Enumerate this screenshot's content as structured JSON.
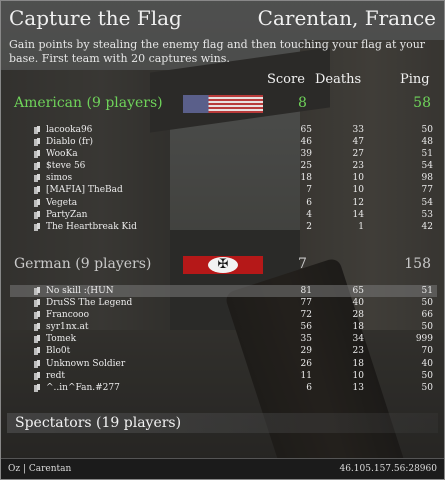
{
  "header": {
    "mode": "Capture the Flag",
    "map": "Carentan, France",
    "description": "Gain points by stealing the enemy flag and then touching your flag at your base. First team with 20 captures wins."
  },
  "columns": {
    "score": "Score",
    "deaths": "Deaths",
    "ping": "Ping"
  },
  "teams": [
    {
      "name": "American (9 players)",
      "score": "8",
      "ping": "58",
      "color": "#6fd35a",
      "players": [
        {
          "name": "lacooka96",
          "score": "65",
          "deaths": "33",
          "ping": "50"
        },
        {
          "name": "Diablo (fr)",
          "score": "46",
          "deaths": "47",
          "ping": "48"
        },
        {
          "name": "WooKa",
          "score": "39",
          "deaths": "27",
          "ping": "51"
        },
        {
          "name": "$teve 56",
          "score": "25",
          "deaths": "23",
          "ping": "54"
        },
        {
          "name": "simos",
          "score": "18",
          "deaths": "10",
          "ping": "98"
        },
        {
          "name": "[MAFIA] TheBad",
          "score": "7",
          "deaths": "10",
          "ping": "77"
        },
        {
          "name": "Vegeta",
          "score": "6",
          "deaths": "12",
          "ping": "54"
        },
        {
          "name": "PartyZan",
          "score": "4",
          "deaths": "14",
          "ping": "53"
        },
        {
          "name": "The Heartbreak Kid",
          "score": "2",
          "deaths": "1",
          "ping": "42"
        }
      ]
    },
    {
      "name": "German (9 players)",
      "score": "7",
      "ping": "158",
      "color": "#c9c9c9",
      "players": [
        {
          "name": "No skill :(HUN",
          "score": "81",
          "deaths": "65",
          "ping": "51"
        },
        {
          "name": "DruSS The Legend",
          "score": "77",
          "deaths": "40",
          "ping": "50"
        },
        {
          "name": "Francooo",
          "score": "72",
          "deaths": "28",
          "ping": "66"
        },
        {
          "name": "syr1nx.at",
          "score": "56",
          "deaths": "18",
          "ping": "50"
        },
        {
          "name": "Tomek",
          "score": "35",
          "deaths": "34",
          "ping": "999"
        },
        {
          "name": "Blo0t",
          "score": "29",
          "deaths": "23",
          "ping": "70"
        },
        {
          "name": "Unknown Soldier",
          "score": "26",
          "deaths": "18",
          "ping": "40"
        },
        {
          "name": "redt",
          "score": "11",
          "deaths": "10",
          "ping": "50"
        },
        {
          "name": "^..in^Fan.#277",
          "score": "6",
          "deaths": "13",
          "ping": "50"
        }
      ]
    }
  ],
  "spectators": "Spectators (19 players)",
  "footer": {
    "left": "Oz | Carentan",
    "right": "46.105.157.56:28960"
  },
  "icons": {
    "player": "ammo-clip-icon"
  }
}
